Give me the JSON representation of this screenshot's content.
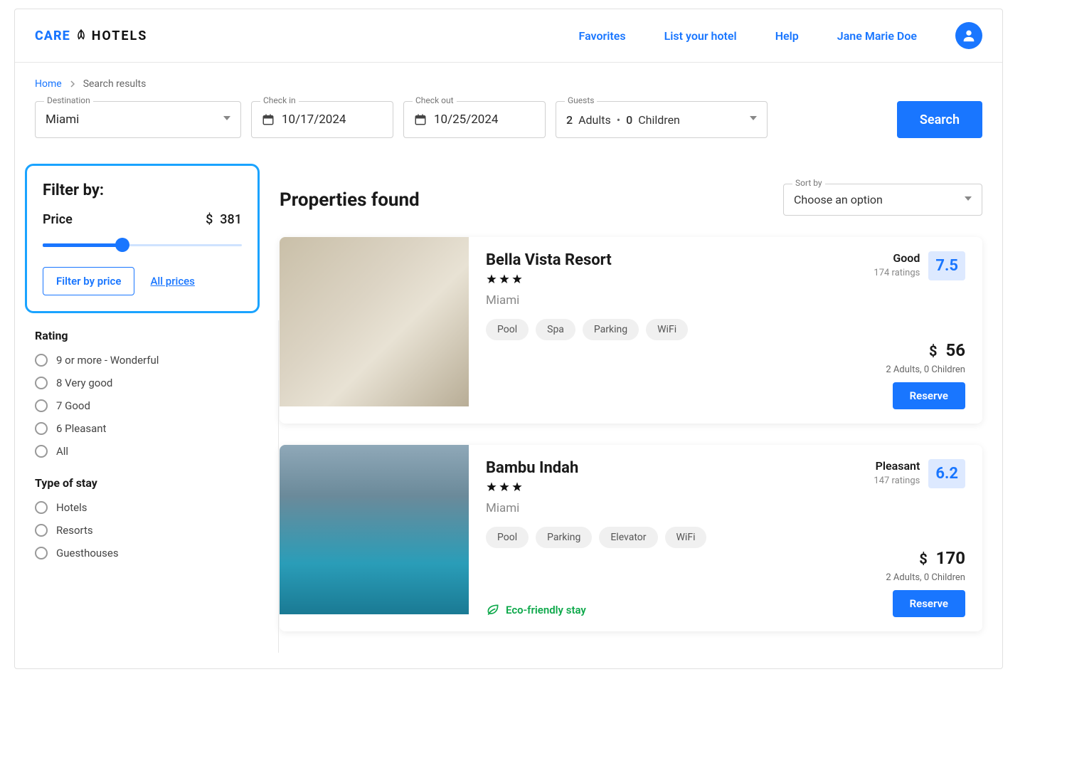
{
  "header": {
    "logo_care": "CARE",
    "logo_hotels": "HOTELS",
    "links": [
      "Favorites",
      "List your hotel",
      "Help"
    ],
    "user": "Jane Marie Doe"
  },
  "breadcrumb": {
    "home": "Home",
    "current": "Search results"
  },
  "search": {
    "destination_label": "Destination",
    "destination_value": "Miami",
    "checkin_label": "Check in",
    "checkin_value": "10/17/2024",
    "checkout_label": "Check out",
    "checkout_value": "10/25/2024",
    "guests_label": "Guests",
    "adults_num": "2",
    "adults_word": "Adults",
    "children_num": "0",
    "children_word": "Children",
    "button": "Search"
  },
  "filters": {
    "title": "Filter by:",
    "price_label": "Price",
    "price_currency": "$",
    "price_value": "381",
    "filter_btn": "Filter by price",
    "all_prices": "All prices",
    "rating_hdr": "Rating",
    "rating_options": [
      "9 or more -  Wonderful",
      "8 Very good",
      "7 Good",
      "6 Pleasant",
      "All"
    ],
    "stay_hdr": "Type of stay",
    "stay_options": [
      "Hotels",
      "Resorts",
      "Guesthouses"
    ]
  },
  "main": {
    "title": "Properties found",
    "sort_label": "Sort by",
    "sort_value": "Choose an option"
  },
  "properties": [
    {
      "name": "Bella Vista Resort",
      "stars": 3,
      "location": "Miami",
      "tags": [
        "Pool",
        "Spa",
        "Parking",
        "WiFi"
      ],
      "rating_word": "Good",
      "rating_count": "174 ratings",
      "rating_score": "7.5",
      "currency": "$",
      "price": "56",
      "guests_line": "2 Adults,  0 Children",
      "reserve": "Reserve",
      "eco": false
    },
    {
      "name": "Bambu Indah",
      "stars": 3,
      "location": "Miami",
      "tags": [
        "Pool",
        "Parking",
        "Elevator",
        "WiFi"
      ],
      "rating_word": "Pleasant",
      "rating_count": "147 ratings",
      "rating_score": "6.2",
      "currency": "$",
      "price": "170",
      "guests_line": "2 Adults,  0 Children",
      "reserve": "Reserve",
      "eco": true,
      "eco_label": "Eco-friendly stay"
    }
  ]
}
